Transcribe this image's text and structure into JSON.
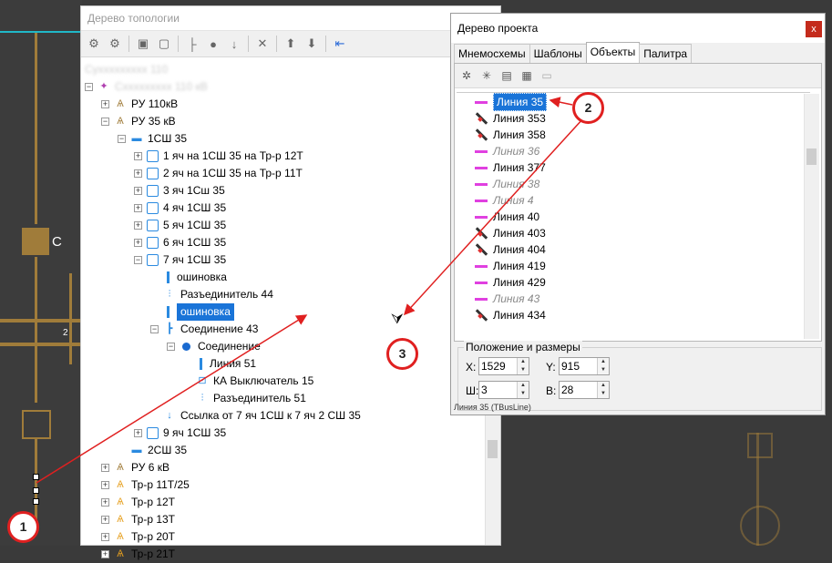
{
  "canvas": {
    "c_label": "С",
    "num_label": "2"
  },
  "topology": {
    "title": "Дерево топологии",
    "toolbar_icons": [
      "tree-add-icon",
      "tree-collapse-icon",
      "shirt-icon",
      "frame-icon",
      "branch-icon",
      "circle-icon",
      "arrow-down-icon",
      "delete-icon",
      "move-up-icon",
      "move-down-icon",
      "move-left-icon"
    ],
    "root_label": "Суххххххххх 110",
    "root_sub": "Сххххххххх 110 кВ",
    "nodes": [
      {
        "label": "РУ 110кВ",
        "icon": "tower",
        "indent": 0,
        "exp": "+"
      },
      {
        "label": "РУ 35 кВ",
        "icon": "tower",
        "indent": 0,
        "exp": "−"
      },
      {
        "label": "1СШ 35",
        "icon": "bus",
        "indent": 1,
        "exp": "−"
      },
      {
        "label": "1 яч на 1СШ 35 на Тр-р 12Т",
        "icon": "cell",
        "indent": 2,
        "exp": "+"
      },
      {
        "label": "2 яч на 1СШ 35 на Тр-р 11Т",
        "icon": "cell",
        "indent": 2,
        "exp": "+"
      },
      {
        "label": "3 яч 1Сш 35",
        "icon": "cell",
        "indent": 2,
        "exp": "+"
      },
      {
        "label": "4 яч 1СШ 35",
        "icon": "cell",
        "indent": 2,
        "exp": "+"
      },
      {
        "label": "5 яч 1СШ 35",
        "icon": "cell",
        "indent": 2,
        "exp": "+"
      },
      {
        "label": "6 яч 1СШ 35",
        "icon": "cell",
        "indent": 2,
        "exp": "+"
      },
      {
        "label": "7 яч 1СШ 35",
        "icon": "cell",
        "indent": 2,
        "exp": "−"
      },
      {
        "label": "ошиновка",
        "icon": "bar",
        "indent": 3,
        "exp": ""
      },
      {
        "label": "Разъединитель 44",
        "icon": "disc",
        "indent": 3,
        "exp": ""
      },
      {
        "label": "ошиновка",
        "icon": "bar",
        "indent": 3,
        "exp": "",
        "selected": true
      },
      {
        "label": "Соединение 43",
        "icon": "conn",
        "indent": 3,
        "exp": "−"
      },
      {
        "label": "Соединение",
        "icon": "dot",
        "indent": 4,
        "exp": "−"
      },
      {
        "label": "Линия 51",
        "icon": "bar",
        "indent": 5,
        "exp": ""
      },
      {
        "label": "КА Выключатель 15",
        "icon": "breaker",
        "indent": 5,
        "exp": ""
      },
      {
        "label": "Разъединитель 51",
        "icon": "disc",
        "indent": 5,
        "exp": ""
      },
      {
        "label": "Ссылка от 7 яч 1СШ к 7 яч 2 СШ 35",
        "icon": "link",
        "indent": 3,
        "exp": ""
      },
      {
        "label": "9 яч 1СШ 35",
        "icon": "cell",
        "indent": 2,
        "exp": "+"
      },
      {
        "label": "2СШ 35",
        "icon": "bus",
        "indent": 1,
        "exp": ""
      },
      {
        "label": "РУ 6 кВ",
        "icon": "tower",
        "indent": 0,
        "exp": "+"
      },
      {
        "label": "Тр-р 11Т/25",
        "icon": "trafo",
        "indent": 0,
        "exp": "+"
      },
      {
        "label": "Тр-р 12Т",
        "icon": "trafo",
        "indent": 0,
        "exp": "+"
      },
      {
        "label": "Тр-р 13Т",
        "icon": "trafo",
        "indent": 0,
        "exp": "+"
      },
      {
        "label": "Тр-р 20Т",
        "icon": "trafo",
        "indent": 0,
        "exp": "+"
      },
      {
        "label": "Тр-р 21Т",
        "icon": "trafo",
        "indent": 0,
        "exp": "+"
      }
    ]
  },
  "project": {
    "title": "Дерево проекта",
    "close": "x",
    "tabs": [
      "Мнемосхемы",
      "Шаблоны",
      "Объекты",
      "Палитра"
    ],
    "active_tab": 2,
    "toolbar_icons": [
      "add-object-icon",
      "remove-object-icon",
      "properties-icon",
      "edit-icon",
      "folder-icon"
    ],
    "items": [
      {
        "label": "Линия 35",
        "type": "bus",
        "selected": true
      },
      {
        "label": "Линия 353",
        "type": "switch"
      },
      {
        "label": "Линия 358",
        "type": "switch"
      },
      {
        "label": "Линия 36",
        "type": "bus",
        "gray": true
      },
      {
        "label": "Линия 377",
        "type": "bus"
      },
      {
        "label": "Линия 38",
        "type": "bus",
        "gray": true
      },
      {
        "label": "Линия 4",
        "type": "bus",
        "gray": true
      },
      {
        "label": "Линия 40",
        "type": "bus"
      },
      {
        "label": "Линия 403",
        "type": "switch"
      },
      {
        "label": "Линия 404",
        "type": "switch"
      },
      {
        "label": "Линия 419",
        "type": "bus"
      },
      {
        "label": "Линия 429",
        "type": "bus"
      },
      {
        "label": "Линия 43",
        "type": "bus",
        "gray": true
      },
      {
        "label": "Линия 434",
        "type": "switch"
      }
    ],
    "position_group": "Положение и размеры",
    "x_label": "X:",
    "x_value": "1529",
    "y_label": "Y:",
    "y_value": "915",
    "w_label": "Ш:",
    "w_value": "3",
    "h_label": "В:",
    "h_value": "28",
    "status": "Линия 35 (TBusLine)"
  },
  "markers": {
    "m1": "1",
    "m2": "2",
    "m3": "3"
  },
  "colors": {
    "accent": "#1a74d8",
    "annotation": "#e02020",
    "busline": "#e040e0",
    "schema": "#a07c3a"
  }
}
